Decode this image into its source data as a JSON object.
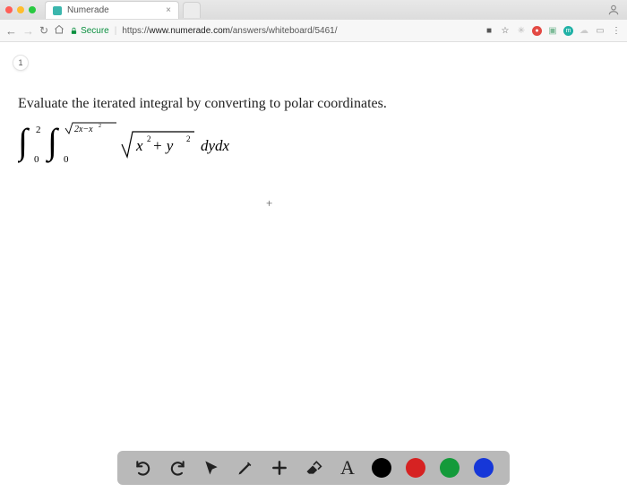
{
  "browser": {
    "tab_title": "Numerade",
    "secure_label": "Secure",
    "url_scheme": "https://",
    "url_domain": "www.numerade.com",
    "url_path": "/answers/whiteboard/5461/"
  },
  "page": {
    "page_number": "1",
    "problem_text": "Evaluate the iterated integral by converting to polar coordinates.",
    "math": {
      "outer_lower": "0",
      "outer_upper": "2",
      "inner_lower": "0",
      "inner_upper_radicand": "2x−x",
      "inner_upper_exponent": "2",
      "integrand_under_root_prefix": "x",
      "integrand_exp1": "2",
      "integrand_plus": " + y",
      "integrand_exp2": "2",
      "differential": "dydx"
    }
  },
  "toolbar": {
    "undo": "undo",
    "redo": "redo",
    "pointer": "pointer",
    "pen": "pen",
    "add": "add",
    "eraser": "eraser",
    "text": "A",
    "colors": {
      "black": "#000000",
      "red": "#d62222",
      "green": "#149a3a",
      "blue": "#1637d8"
    }
  }
}
